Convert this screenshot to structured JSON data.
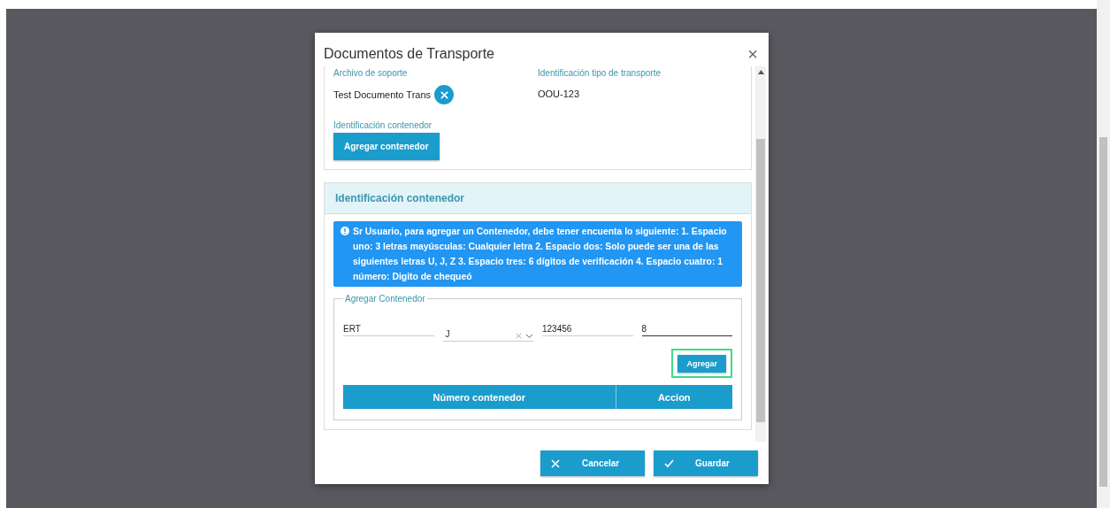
{
  "dialog": {
    "title": "Documentos de Transporte",
    "close": "×"
  },
  "document_section": {
    "support_file_label": "Archivo de soporte",
    "support_file": "Test Documento Trans",
    "transport_id_label": "Identificación tipo de transporte",
    "transport_id": "OOU-123",
    "container_label": "Identificación contenedor",
    "add_container_button": "Agregar contenedor"
  },
  "container_panel": {
    "title": "Identificación contenedor",
    "info": "Sr Usuario, para agregar un Contenedor, debe tener encuenta lo siguiente: 1. Espacio uno: 3 letras mayúsculas: Cualquier letra 2. Espacio dos: Solo puede ser una de las siguientes letras U, J, Z 3. Espacio tres: 6 dígitos de verificación 4. Espacio cuatro: 1 número: Digito de chequeó",
    "fieldset": {
      "legend": "Agregar Contenedor",
      "fields": [
        {
          "kind": "text",
          "value": "ERT",
          "focused": false
        },
        {
          "kind": "select",
          "value": "J",
          "focused": false
        },
        {
          "kind": "text",
          "value": "123456",
          "focused": false
        },
        {
          "kind": "text",
          "value": "8",
          "focused": true
        }
      ],
      "add_button": "Agregar",
      "add_button_highlighted": true,
      "table": {
        "columns": [
          "Número contenedor",
          "Accion"
        ]
      }
    }
  },
  "footer": {
    "buttons": [
      {
        "kind": "cancel",
        "label": "Cancelar"
      },
      {
        "kind": "save",
        "label": "Guardar"
      }
    ]
  }
}
